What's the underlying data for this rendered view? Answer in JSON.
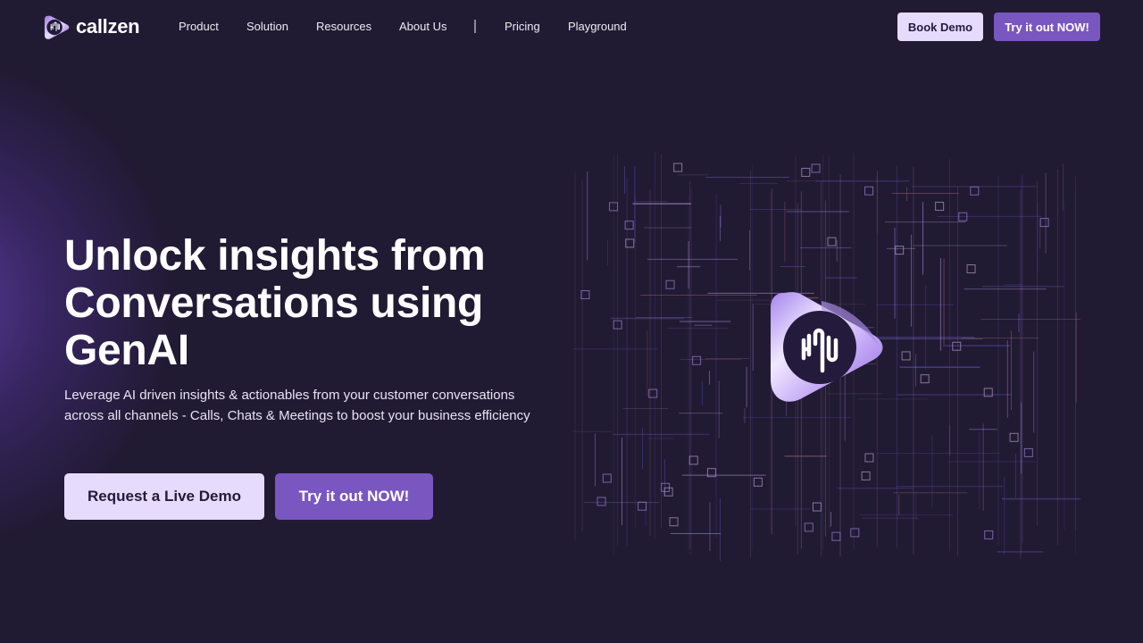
{
  "brand": {
    "name": "callzen",
    "logo_icon": "callzen-waveform-logo-icon",
    "colors": {
      "background": "#211a33",
      "accent_purple": "#7a56c0",
      "accent_light": "#e6dbfd",
      "text_dark": "#231a3c"
    }
  },
  "nav": {
    "links": [
      {
        "label": "Product"
      },
      {
        "label": "Solution"
      },
      {
        "label": "Resources"
      },
      {
        "label": "About Us"
      },
      {
        "label": "Pricing"
      },
      {
        "label": "Playground"
      }
    ],
    "book_demo_label": "Book Demo",
    "try_now_label": "Try it out NOW!"
  },
  "hero": {
    "title": "Unlock insights from\nConversations  using\nGenAI",
    "subtitle": "Leverage AI driven insights & actionables from your customer conversations across all channels - Calls, Chats & Meetings to boost your business efficiency",
    "primary_cta_label": "Request a Live Demo",
    "secondary_cta_label": "Try it out NOW!",
    "illustration_icon": "circuit-board-with-callzen-logo-icon"
  }
}
